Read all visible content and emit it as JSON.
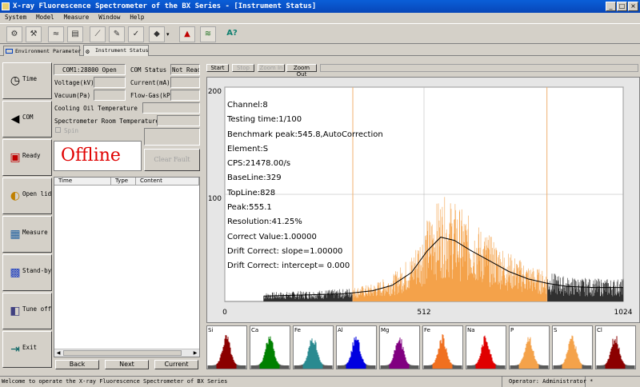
{
  "window": {
    "title": "X-ray Fluorescence Spectrometer of the BX Series - [Instrument Status]"
  },
  "menu": [
    "System",
    "Model",
    "Measure",
    "Window",
    "Help"
  ],
  "tabs": [
    {
      "label": "Environment Parameter"
    },
    {
      "label": "Instrument Status"
    }
  ],
  "nav": [
    {
      "label": "Time",
      "icon": "clock-icon"
    },
    {
      "label": "COM",
      "icon": "speaker-icon"
    },
    {
      "label": "Ready",
      "icon": "ready-icon"
    },
    {
      "label": "Open lid",
      "icon": "lid-icon"
    },
    {
      "label": "Measure",
      "icon": "measure-icon"
    },
    {
      "label": "Stand-by",
      "icon": "standby-icon"
    },
    {
      "label": "Tune off",
      "icon": "tune-off-icon"
    },
    {
      "label": "Exit",
      "icon": "exit-icon"
    }
  ],
  "status": {
    "com_port": "COM1:28800 Open",
    "com_status_label": "COM Status",
    "com_status_value": "Not Ready",
    "voltage_label": "Voltage(kV)",
    "current_label": "Current(mA)",
    "vacuum_label": "Vacuum(Pa)",
    "flowgas_label": "Flow-Gas(kPa",
    "cooling_label": "Cooling Oil Temperature",
    "room_label": "Spectrometer Room Temperature",
    "spin_label": "Spin",
    "offline_text": "Offline",
    "clear_fault": "Clear Fault"
  },
  "log": {
    "columns": [
      "Time",
      "Type",
      "Content"
    ]
  },
  "log_buttons": {
    "back": "Back",
    "next": "Next",
    "current": "Current"
  },
  "controls": {
    "start": "Start",
    "stop": "Stop",
    "zoom_in": "Zoom In",
    "zoom_out": "Zoom Out"
  },
  "spectrum": {
    "channel": "Channel:8",
    "testing_time": "Testing time:1/100",
    "benchmark": "Benchmark peak:545.8,AutoCorrection",
    "element": "Element:S",
    "cps": "CPS:21478.00/s",
    "baseline": "BaseLine:329",
    "topline": "TopLine:828",
    "peak": "Peak:555.1",
    "resolution": "Resolution:41.25%",
    "correct_value": "Correct Value:1.00000",
    "drift_slope": "Drift Correct: slope=1.00000",
    "drift_intercept": "Drift Correct: intercept=  0.000",
    "y_ticks": [
      "200",
      "100"
    ],
    "x_ticks": [
      "0",
      "512",
      "1024"
    ],
    "colors": {
      "highlight": "#f4a24a",
      "noise": "#303030",
      "fit": "#000000",
      "grid": "#b0b0b0",
      "bound": "#f0b070"
    }
  },
  "chart_data": {
    "type": "area",
    "title": "",
    "xlabel": "",
    "ylabel": "",
    "xlim": [
      0,
      1024
    ],
    "ylim": [
      0,
      200
    ],
    "x_ticks": [
      0,
      512,
      1024
    ],
    "y_ticks": [
      100,
      200
    ],
    "baseline_channel": 329,
    "topline_channel": 828,
    "peak_channel": 555.1,
    "series": [
      {
        "x": [
          100,
          200,
          300,
          329,
          380,
          430,
          480,
          520,
          555,
          590,
          630,
          680,
          730,
          780,
          828,
          880,
          950,
          1024
        ],
        "values": [
          5,
          6,
          7,
          8,
          10,
          15,
          27,
          47,
          60,
          57,
          48,
          38,
          28,
          21,
          17,
          14,
          13,
          13
        ]
      }
    ]
  },
  "thumbnails": [
    {
      "label": "Si",
      "color": "#8b0000"
    },
    {
      "label": "Ca",
      "color": "#008000"
    },
    {
      "label": "Fe",
      "color": "#2a8a90"
    },
    {
      "label": "Al",
      "color": "#0000e0"
    },
    {
      "label": "Mg",
      "color": "#800080"
    },
    {
      "label": "Fe",
      "color": "#f07020"
    },
    {
      "label": "Na",
      "color": "#e00000"
    },
    {
      "label": "P",
      "color": "#f4a24a"
    },
    {
      "label": "S",
      "color": "#f4a24a"
    },
    {
      "label": "Cl",
      "color": "#8b0000"
    }
  ],
  "statusbar": {
    "message": "Welcome to operate the X-ray Fluorescence Spectrometer of BX Series",
    "operator": "Operator: Administrator *"
  }
}
